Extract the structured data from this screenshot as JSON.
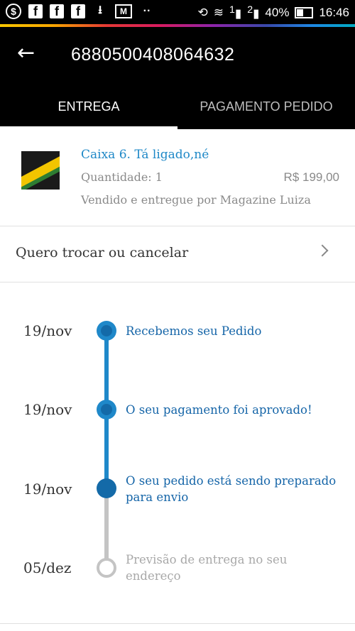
{
  "status_bar": {
    "icons_left": [
      "dollar-icon",
      "facebook-icon",
      "facebook-icon",
      "facebook-icon",
      "download-icon",
      "gmail-icon",
      "dots-icon"
    ],
    "signal1_label": "1",
    "signal2_label": "2",
    "battery": "40%",
    "time": "16:46"
  },
  "header": {
    "order_number": "6880500408064632",
    "tabs": [
      {
        "label": "ENTREGA",
        "active": true
      },
      {
        "label": "PAGAMENTO PEDIDO",
        "active": false
      }
    ]
  },
  "product": {
    "title": "Caixa 6. Tá ligado,né",
    "quantity": "Quantidade: 1",
    "price": "R$ 199,00",
    "seller": "Vendido e entregue por Magazine Luiza"
  },
  "exchange": {
    "label": "Quero trocar ou cancelar"
  },
  "timeline": [
    {
      "date": "19/nov",
      "text": "Recebemos seu Pedido",
      "status": "done"
    },
    {
      "date": "19/nov",
      "text": "O seu pagamento foi aprovado!",
      "status": "done"
    },
    {
      "date": "19/nov",
      "text": "O seu pedido está sendo preparado para envio",
      "status": "current"
    },
    {
      "date": "05/dez",
      "text": "Previsão de entrega no seu endereço",
      "status": "pending"
    }
  ],
  "colors": {
    "accent_blue": "#1f88c9",
    "dark_blue": "#146aa8",
    "pending_grey": "#c4c4c4",
    "header_bg": "#000000"
  }
}
